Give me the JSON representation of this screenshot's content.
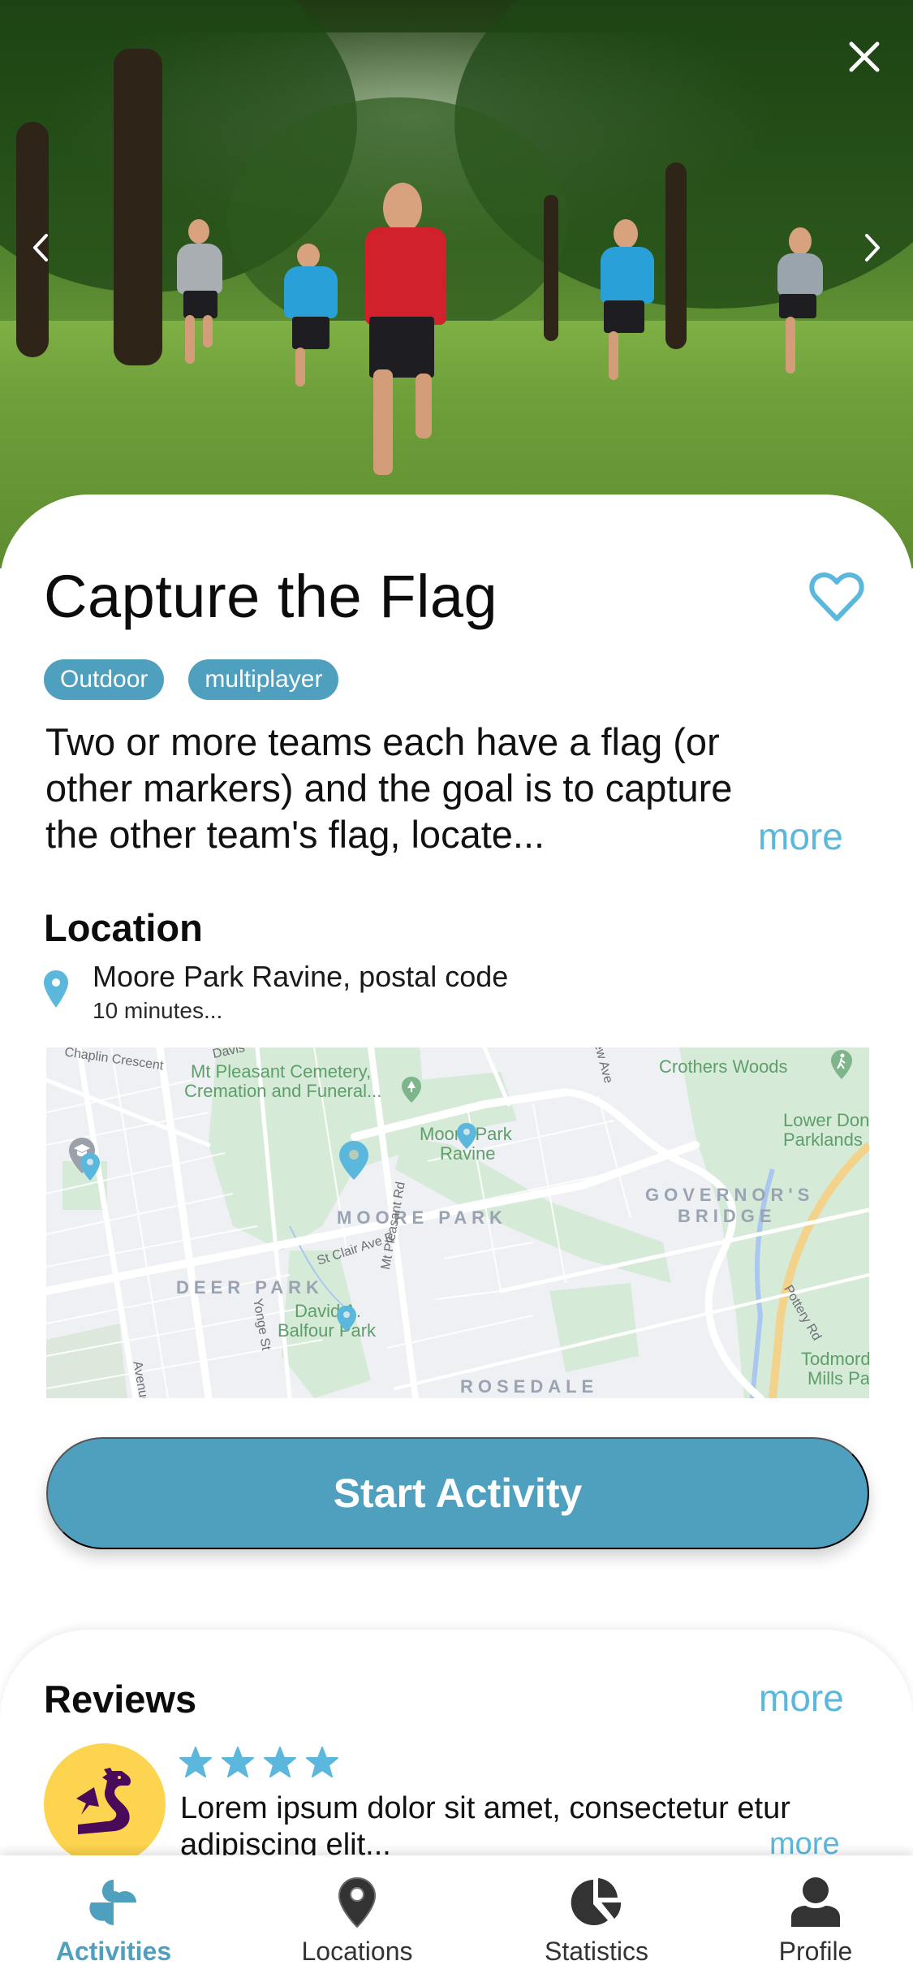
{
  "hero": {
    "image_alt": "Kids running across a park lawn",
    "close_icon": "close-icon",
    "prev_icon": "chevron-left-icon",
    "next_icon": "chevron-right-icon"
  },
  "activity": {
    "title": "Capture the Flag",
    "favorite_icon": "heart-outline-icon",
    "tags": [
      "Outdoor",
      "multiplayer"
    ],
    "description_lines": [
      "Two or more teams each have a flag (or",
      "other markers) and the goal is to capture",
      "the other team's flag, locate..."
    ],
    "more_label": "more"
  },
  "location": {
    "title": "Location",
    "address": "Moore Park Ravine, postal code",
    "distance": "10 minutes...",
    "map": {
      "labels": {
        "chaplin": "Chaplin Crescent",
        "cemetery_1": "Mt Pleasant Cemetery,",
        "cemetery_2": "Cremation and Funeral...",
        "ravine_1": "Moore Park",
        "ravine_2": "Ravine",
        "crothers": "Crothers Woods",
        "lower_don_1": "Lower Don",
        "lower_don_2": "Parklands",
        "moore_park": "MOORE PARK",
        "governors_1": "GOVERNOR'S",
        "governors_2": "BRIDGE",
        "deer_park": "DEER PARK",
        "st_clair": "St Clair Ave E",
        "mt_pleasant_rd": "Mt Pleasant Rd",
        "yonge": "Yonge St",
        "balfour_1": "David A.",
        "balfour_2": "Balfour Park",
        "pottery": "Pottery Rd",
        "todmorden_1": "Todmorden",
        "todmorden_2": "Mills Park",
        "rosedale": "ROSEDALE",
        "avenue": "Avenue",
        "davis": "Davis",
        "new_ave": "ew Ave"
      }
    }
  },
  "actions": {
    "start_label": "Start Activity"
  },
  "reviews": {
    "title": "Reviews",
    "more_label": "more",
    "items": [
      {
        "rating": 4,
        "text_line_1": "Lorem ipsum dolor sit amet, consectetur etur",
        "text_line_2": "adipiscing elit...",
        "more_label": "more",
        "avatar_icon": "dragon-icon"
      }
    ]
  },
  "nav": {
    "items": [
      {
        "label": "Activities",
        "icon": "pinwheel-icon",
        "active": true
      },
      {
        "label": "Locations",
        "icon": "map-pin-icon",
        "active": false
      },
      {
        "label": "Statistics",
        "icon": "pie-chart-icon",
        "active": false
      },
      {
        "label": "Profile",
        "icon": "person-icon",
        "active": false
      }
    ]
  },
  "colors": {
    "accent": "#4f9fbe",
    "link": "#5bb8dc",
    "avatar_bg": "#fdd44f",
    "avatar_fg": "#4a0a5a",
    "nav_inactive": "#333333"
  }
}
